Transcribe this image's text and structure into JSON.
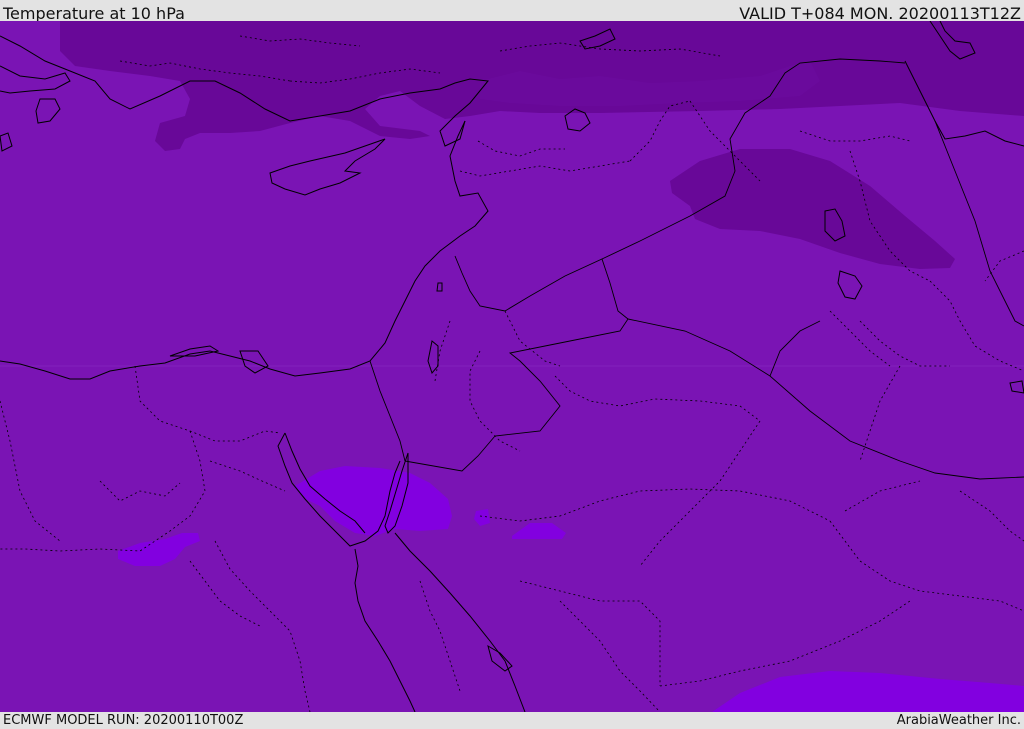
{
  "header": {
    "title": "Temperature at 10 hPa",
    "valid": "VALID T+084 MON. 20200113T12Z"
  },
  "footer": {
    "model_run": "ECMWF MODEL RUN: 20200110T00Z",
    "credit": "ArabiaWeather Inc."
  },
  "colors": {
    "background_field": "#7a14b4",
    "cold_band": "#680898",
    "warm_patch": "#8200e0",
    "coastline": "#000000"
  }
}
